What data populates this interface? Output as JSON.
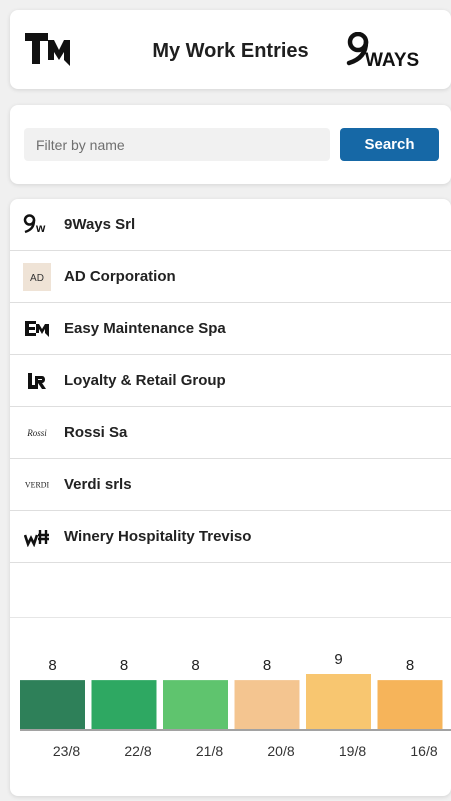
{
  "header": {
    "title": "My Work Entries",
    "left_logo": "TM",
    "right_logo": "9WAYS"
  },
  "search": {
    "placeholder": "Filter by name",
    "value": "",
    "button_label": "Search",
    "button_color": "#1668a6"
  },
  "companies": [
    {
      "name": "9Ways Srl",
      "logo_text": "9w"
    },
    {
      "name": "AD Corporation",
      "logo_text": "AD"
    },
    {
      "name": "Easy Maintenance Spa",
      "logo_text": "EM"
    },
    {
      "name": "Loyalty & Retail Group",
      "logo_text": "LR"
    },
    {
      "name": "Rossi Sa",
      "logo_text": "Rossi"
    },
    {
      "name": "Verdi srls",
      "logo_text": "VERDI"
    },
    {
      "name": "Winery Hospitality Treviso",
      "logo_text": "wH"
    }
  ],
  "chart_data": {
    "type": "bar",
    "categories": [
      "23/8",
      "22/8",
      "21/8",
      "20/8",
      "19/8",
      "16/8"
    ],
    "values": [
      8,
      8,
      8,
      8,
      9,
      8
    ],
    "colors": [
      "#2e8059",
      "#2ea862",
      "#5fc46e",
      "#f4c590",
      "#f8c670",
      "#f6b45a"
    ],
    "ylim": [
      0,
      9
    ],
    "data_labels": true,
    "grid": false
  }
}
